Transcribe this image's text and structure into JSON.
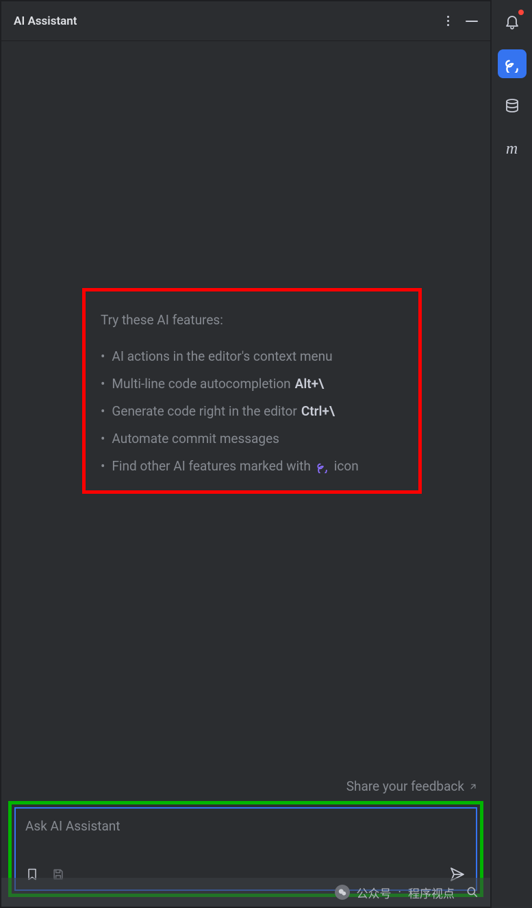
{
  "header": {
    "title": "AI Assistant"
  },
  "features": {
    "title": "Try these AI features:",
    "items": {
      "i0": {
        "text": "AI actions in the editor's context menu"
      },
      "i1": {
        "text": "Multi-line code autocompletion",
        "shortcut": "Alt+\\"
      },
      "i2": {
        "text": "Generate code right in the editor",
        "shortcut": "Ctrl+\\"
      },
      "i3": {
        "text": "Automate commit messages"
      },
      "i4": {
        "text_before": "Find other AI features marked with",
        "text_after": "icon"
      }
    }
  },
  "feedback": {
    "label": "Share your feedback"
  },
  "input": {
    "placeholder": "Ask AI Assistant"
  },
  "watermark": {
    "label": "公众号",
    "separator": "·",
    "name": "程序视点"
  }
}
